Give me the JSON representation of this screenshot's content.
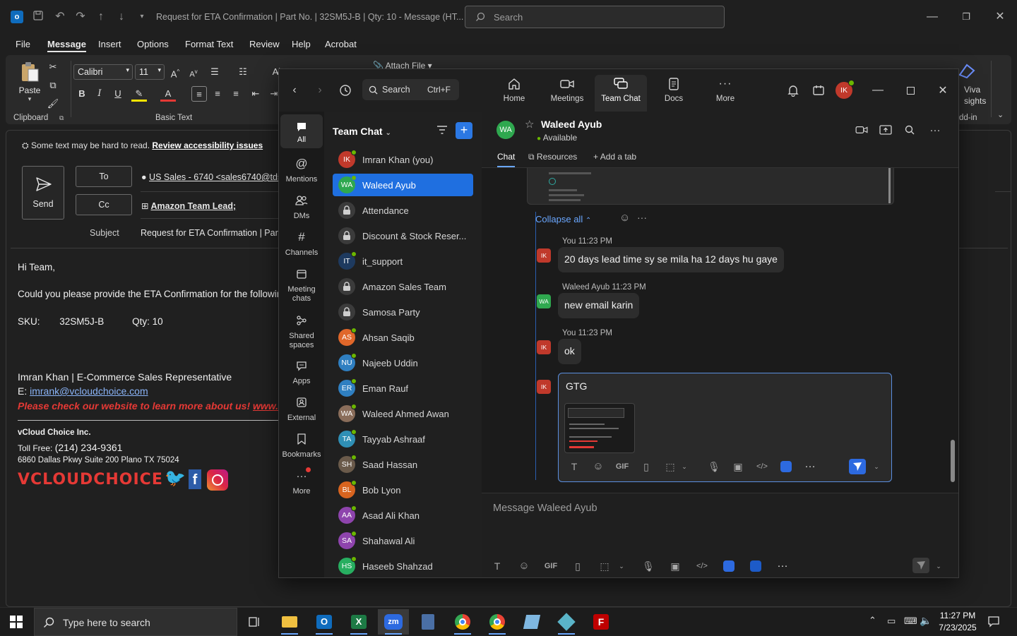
{
  "outlook": {
    "window_title": "Request for ETA Confirmation | Part No. | 32SM5J-B | Qty: 10  -  Message (HT...",
    "search_placeholder": "Search",
    "menu": [
      "File",
      "Message",
      "Insert",
      "Options",
      "Format Text",
      "Review",
      "Help",
      "Acrobat"
    ],
    "active_menu": "Message",
    "ribbon": {
      "paste_label": "Paste",
      "clipboard_label": "Clipboard",
      "font_name": "Calibri",
      "font_size": "11",
      "basic_text_label": "Basic Text",
      "attach_file_label": "Attach File",
      "viva_label": "Viva",
      "insights_label": "sights",
      "addin_label": "dd-in"
    },
    "accessibility": {
      "text": "Some text may be hard to read.",
      "link": "Review accessibility issues"
    },
    "send_label": "Send",
    "to_label": "To",
    "cc_label": "Cc",
    "to_value": "US Sales - 6740 <sales6740@tdsyn",
    "cc_value": "Amazon Team Lead;",
    "subject_label": "Subject",
    "subject_value": "Request for ETA Confirmation | Part N",
    "body": {
      "greeting": "Hi Team,",
      "line1": "Could you please provide the ETA Confirmation for the followin",
      "sku_label": "SKU:",
      "sku_value": "32SM5J-B",
      "qty_label": "Qty: 10",
      "sig_name": "Imran Khan | E-Commerce Sales Representative",
      "sig_email_label": "E:",
      "sig_email": "imrank@vcloudchoice.com",
      "sig_website": "Please check our website to learn more about us!",
      "sig_website_link": "www.",
      "company": "vCloud Choice Inc.",
      "tollfree_label": "Toll Free:",
      "tollfree_value": "(214) 234-9361",
      "address": "6860 Dallas Pkwy Suite 200 Plano TX 75024",
      "logo_text": "VCLOUDCHOICE"
    }
  },
  "teams": {
    "search_label": "Search",
    "search_shortcut": "Ctrl+F",
    "nav": [
      {
        "label": "Home",
        "icon": "home-icon"
      },
      {
        "label": "Meetings",
        "icon": "video-icon"
      },
      {
        "label": "Team Chat",
        "icon": "chat-icon"
      },
      {
        "label": "Docs",
        "icon": "docs-icon"
      },
      {
        "label": "More",
        "icon": "more-icon"
      }
    ],
    "active_nav": "Team Chat",
    "profile_initials": "IK",
    "rail": [
      {
        "label": "All",
        "icon": "chat-bubble-icon"
      },
      {
        "label": "Mentions",
        "icon": "at-icon"
      },
      {
        "label": "DMs",
        "icon": "people-icon"
      },
      {
        "label": "Channels",
        "icon": "hash-icon"
      },
      {
        "label": "Meeting chats",
        "icon": "calendar-icon"
      },
      {
        "label": "Shared spaces",
        "icon": "share-icon"
      },
      {
        "label": "Apps",
        "icon": "apps-icon"
      },
      {
        "label": "External",
        "icon": "external-icon"
      },
      {
        "label": "Bookmarks",
        "icon": "bookmark-icon"
      },
      {
        "label": "More",
        "icon": "more-icon"
      }
    ],
    "chat_list_title": "Team Chat",
    "chats": [
      {
        "name": "Imran Khan (you)",
        "initials": "IK",
        "color": "#c0392b",
        "online": true
      },
      {
        "name": "Waleed Ayub",
        "initials": "WA",
        "color": "#2fa84f",
        "online": true,
        "active": true
      },
      {
        "name": "Attendance",
        "initials": "",
        "color": "#3b3b3b",
        "lock": true
      },
      {
        "name": "Discount & Stock Reser...",
        "initials": "",
        "color": "#3b3b3b",
        "lock": true
      },
      {
        "name": "it_support",
        "initials": "IT",
        "color": "#1e3a5f",
        "online": true
      },
      {
        "name": "Amazon Sales Team",
        "initials": "",
        "color": "#3b3b3b",
        "lock": true
      },
      {
        "name": "Samosa Party",
        "initials": "",
        "color": "#3b3b3b",
        "lock": true
      },
      {
        "name": "Ahsan Saqib",
        "initials": "AS",
        "color": "#e0672a",
        "online": true
      },
      {
        "name": "Najeeb Uddin",
        "initials": "NU",
        "color": "#2f7fc1",
        "online": true
      },
      {
        "name": "Eman Rauf",
        "initials": "ER",
        "color": "#2f7fc1",
        "online": true
      },
      {
        "name": "Waleed Ahmed Awan",
        "initials": "WA",
        "color": "#8a6d5a",
        "online": true
      },
      {
        "name": "Tayyab Ashraaf",
        "initials": "TA",
        "color": "#2f8fb5",
        "online": true
      },
      {
        "name": "Saad Hassan",
        "initials": "SH",
        "color": "#6a5a4a",
        "online": true
      },
      {
        "name": "Bob Lyon",
        "initials": "BL",
        "color": "#d8641f",
        "online": true
      },
      {
        "name": "Asad Ali Khan",
        "initials": "AA",
        "color": "#8e44ad",
        "online": true
      },
      {
        "name": "Shahawal Ali",
        "initials": "SA",
        "color": "#8e44ad",
        "online": true
      },
      {
        "name": "Haseeb Shahzad",
        "initials": "HS",
        "color": "#27ae60",
        "online": true
      }
    ],
    "chat_header": {
      "initials": "WA",
      "name": "Waleed Ayub",
      "status": "Available"
    },
    "tabs": [
      "Chat",
      "Resources",
      "Add a tab"
    ],
    "collapse_all": "Collapse all",
    "messages": [
      {
        "sender": "You",
        "time": "11:23 PM",
        "initials": "IK",
        "text": "20 days lead time  sy se mila ha  12 days hu gaye"
      },
      {
        "sender": "Waleed Ayub",
        "time": "11:23 PM",
        "initials": "WA",
        "text": "new email karin"
      },
      {
        "sender": "You",
        "time": "11:23 PM",
        "initials": "IK",
        "text": "ok"
      }
    ],
    "draft_text": "GTG",
    "draft_initials": "IK",
    "message_placeholder": "Message Waleed Ayub"
  },
  "taskbar": {
    "search_placeholder": "Type here to search",
    "time": "11:27 PM",
    "date": "7/23/2025"
  }
}
